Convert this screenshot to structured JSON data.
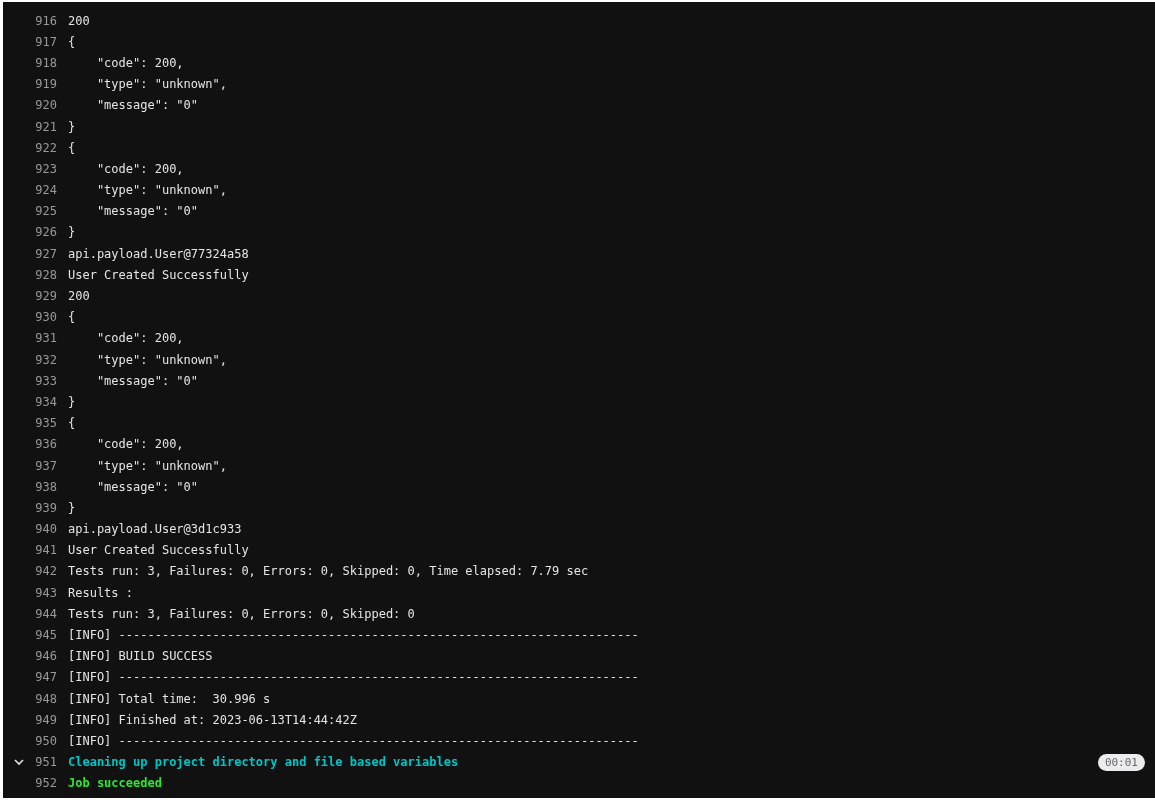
{
  "log": {
    "lines": [
      {
        "number": "916",
        "text": "200",
        "kind": "plain"
      },
      {
        "number": "917",
        "text": "{",
        "kind": "plain"
      },
      {
        "number": "918",
        "text": "    \"code\": 200,",
        "kind": "plain"
      },
      {
        "number": "919",
        "text": "    \"type\": \"unknown\",",
        "kind": "plain"
      },
      {
        "number": "920",
        "text": "    \"message\": \"0\"",
        "kind": "plain"
      },
      {
        "number": "921",
        "text": "}",
        "kind": "plain"
      },
      {
        "number": "922",
        "text": "{",
        "kind": "plain"
      },
      {
        "number": "923",
        "text": "    \"code\": 200,",
        "kind": "plain"
      },
      {
        "number": "924",
        "text": "    \"type\": \"unknown\",",
        "kind": "plain"
      },
      {
        "number": "925",
        "text": "    \"message\": \"0\"",
        "kind": "plain"
      },
      {
        "number": "926",
        "text": "}",
        "kind": "plain"
      },
      {
        "number": "927",
        "text": "api.payload.User@77324a58",
        "kind": "plain"
      },
      {
        "number": "928",
        "text": "User Created Successfully",
        "kind": "plain"
      },
      {
        "number": "929",
        "text": "200",
        "kind": "plain"
      },
      {
        "number": "930",
        "text": "{",
        "kind": "plain"
      },
      {
        "number": "931",
        "text": "    \"code\": 200,",
        "kind": "plain"
      },
      {
        "number": "932",
        "text": "    \"type\": \"unknown\",",
        "kind": "plain"
      },
      {
        "number": "933",
        "text": "    \"message\": \"0\"",
        "kind": "plain"
      },
      {
        "number": "934",
        "text": "}",
        "kind": "plain"
      },
      {
        "number": "935",
        "text": "{",
        "kind": "plain"
      },
      {
        "number": "936",
        "text": "    \"code\": 200,",
        "kind": "plain"
      },
      {
        "number": "937",
        "text": "    \"type\": \"unknown\",",
        "kind": "plain"
      },
      {
        "number": "938",
        "text": "    \"message\": \"0\"",
        "kind": "plain"
      },
      {
        "number": "939",
        "text": "}",
        "kind": "plain"
      },
      {
        "number": "940",
        "text": "api.payload.User@3d1c933",
        "kind": "plain"
      },
      {
        "number": "941",
        "text": "User Created Successfully",
        "kind": "plain"
      },
      {
        "number": "942",
        "text": "Tests run: 3, Failures: 0, Errors: 0, Skipped: 0, Time elapsed: 7.79 sec",
        "kind": "plain"
      },
      {
        "number": "943",
        "text": "Results :",
        "kind": "plain"
      },
      {
        "number": "944",
        "text": "Tests run: 3, Failures: 0, Errors: 0, Skipped: 0",
        "kind": "plain"
      },
      {
        "number": "945",
        "text": "[INFO] ------------------------------------------------------------------------",
        "kind": "plain"
      },
      {
        "number": "946",
        "text": "[INFO] BUILD SUCCESS",
        "kind": "plain"
      },
      {
        "number": "947",
        "text": "[INFO] ------------------------------------------------------------------------",
        "kind": "plain"
      },
      {
        "number": "948",
        "text": "[INFO] Total time:  30.996 s",
        "kind": "plain"
      },
      {
        "number": "949",
        "text": "[INFO] Finished at: 2023-06-13T14:44:42Z",
        "kind": "plain"
      },
      {
        "number": "950",
        "text": "[INFO] ------------------------------------------------------------------------",
        "kind": "plain"
      },
      {
        "number": "951",
        "text": "Cleaning up project directory and file based variables",
        "kind": "section",
        "expanded": true,
        "duration": "00:01"
      },
      {
        "number": "952",
        "text": "Job succeeded",
        "kind": "success"
      }
    ]
  }
}
